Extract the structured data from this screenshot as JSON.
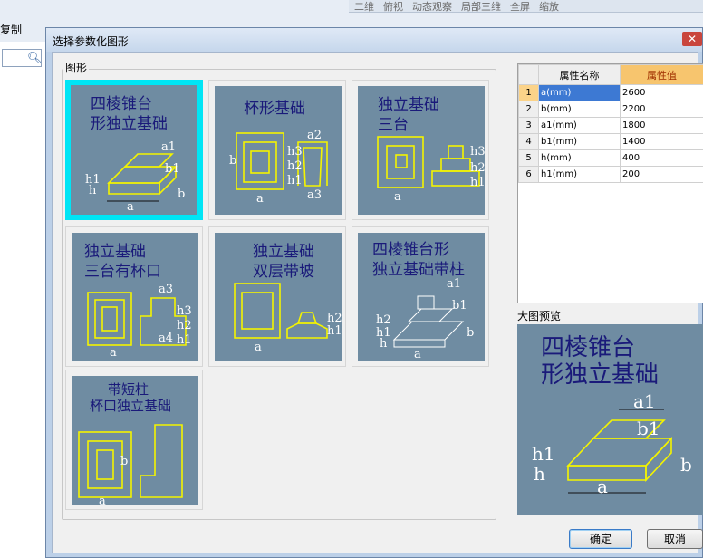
{
  "background_app": {
    "toolbar_items": [
      "二维",
      "俯视",
      "动态观察",
      "局部三维",
      "全屏",
      "缩放"
    ],
    "copy_label": "复制"
  },
  "dialog": {
    "title": "选择参数化图形",
    "group_label": "图形",
    "shapes": [
      {
        "caption": [
          "四棱锥台",
          "形独立基础"
        ],
        "selected": true
      },
      {
        "caption": [
          "杯形基础"
        ],
        "selected": false
      },
      {
        "caption": [
          "独立基础",
          "三台"
        ],
        "selected": false
      },
      {
        "caption": [
          "独立基础",
          "三台有杯口"
        ],
        "selected": false
      },
      {
        "caption": [
          "独立基础",
          "双层带坡"
        ],
        "selected": false
      },
      {
        "caption": [
          "四棱锥台形",
          "独立基础带柱"
        ],
        "selected": false
      },
      {
        "caption": [
          "带短柱",
          "杯口独立基础"
        ],
        "selected": false
      }
    ],
    "properties": {
      "col_name": "属性名称",
      "col_value": "属性值",
      "rows": [
        {
          "index": "1",
          "name": "a(mm)",
          "value": "2600"
        },
        {
          "index": "2",
          "name": "b(mm)",
          "value": "2200"
        },
        {
          "index": "3",
          "name": "a1(mm)",
          "value": "1800"
        },
        {
          "index": "4",
          "name": "b1(mm)",
          "value": "1400"
        },
        {
          "index": "5",
          "name": "h(mm)",
          "value": "400"
        },
        {
          "index": "6",
          "name": "h1(mm)",
          "value": "200"
        }
      ]
    },
    "preview_label": "大图预览",
    "preview_caption": [
      "四棱锥台",
      "形独立基础"
    ],
    "dim_labels": {
      "a": "a",
      "b": "b",
      "a1": "a1",
      "b1": "b1",
      "h": "h",
      "h1": "h1"
    },
    "ok_label": "确定",
    "cancel_label": "取消"
  }
}
